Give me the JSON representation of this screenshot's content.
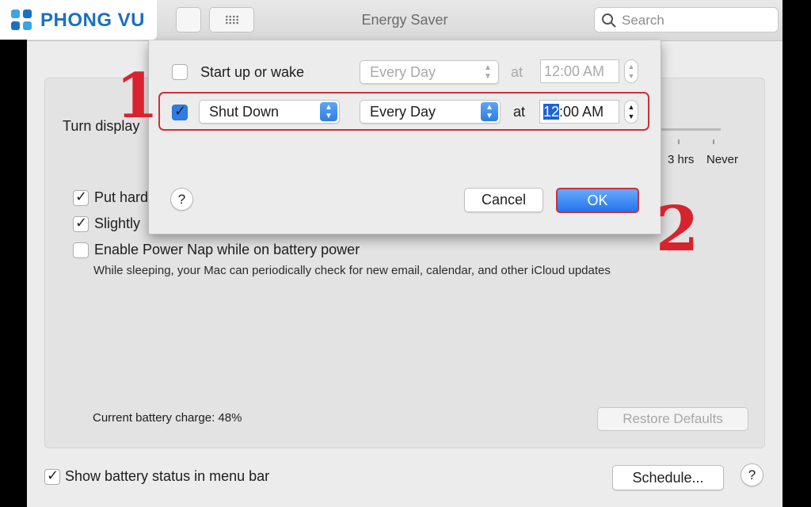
{
  "logo": {
    "text": "PHONG VU",
    "color": "#1b6fc4"
  },
  "window": {
    "title": "Energy Saver",
    "search_placeholder": "Search"
  },
  "panel": {
    "turn_display_label": "Turn display",
    "slider_labels": [
      "3 hrs",
      "Never"
    ],
    "options": [
      {
        "label": "Put hard",
        "checked": true
      },
      {
        "label": "Slightly",
        "checked": true
      },
      {
        "label": "Enable Power Nap while on battery power",
        "checked": false
      }
    ],
    "power_nap_description": "While sleeping, your Mac can periodically check for new email, calendar, and other iCloud updates",
    "battery_charge": "Current battery charge: 48%",
    "restore_defaults": "Restore Defaults",
    "show_battery_status": "Show battery status in menu bar",
    "schedule_button": "Schedule...",
    "help": "?"
  },
  "schedule_sheet": {
    "row1": {
      "label": "Start up or wake",
      "checked": false,
      "day": "Every Day",
      "at": "at",
      "time": "12:00 AM"
    },
    "row2": {
      "event": "Shut Down",
      "checked": true,
      "day": "Every Day",
      "at": "at",
      "time_selected": "12",
      "time_rest": ":00 AM"
    },
    "help": "?",
    "cancel": "Cancel",
    "ok": "OK"
  },
  "annotations": {
    "step1": "1",
    "step2": "2",
    "color": "#d8232e"
  }
}
